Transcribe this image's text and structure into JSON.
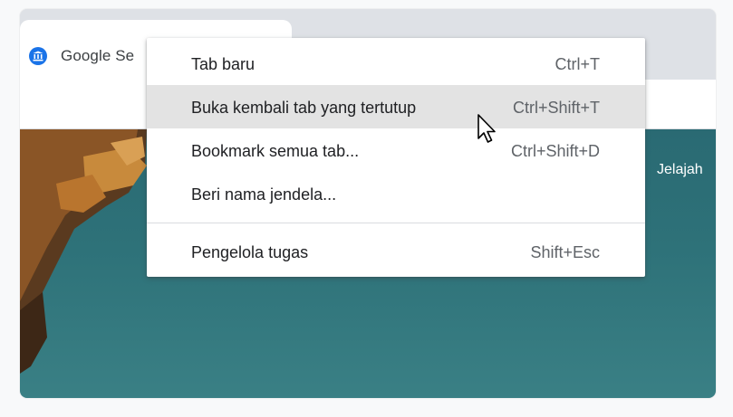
{
  "browser": {
    "tab": {
      "title": "Google Se",
      "favicon": "museum-icon"
    }
  },
  "page": {
    "explore_link": "Jelajah"
  },
  "context_menu": {
    "items": [
      {
        "label": "Tab baru",
        "shortcut": "Ctrl+T",
        "highlighted": false
      },
      {
        "label": "Buka kembali tab yang tertutup",
        "shortcut": "Ctrl+Shift+T",
        "highlighted": true
      },
      {
        "label": "Bookmark semua tab...",
        "shortcut": "Ctrl+Shift+D",
        "highlighted": false
      },
      {
        "label": "Beri nama jendela...",
        "shortcut": "",
        "highlighted": false
      },
      {
        "label": "Pengelola tugas",
        "shortcut": "Shift+Esc",
        "highlighted": false
      }
    ]
  },
  "colors": {
    "menu_highlight": "#e3e3e3",
    "page_background": "#2e7279",
    "favicon": "#1a73e8"
  },
  "cursor": {
    "icon": "arrow-cursor-icon"
  }
}
